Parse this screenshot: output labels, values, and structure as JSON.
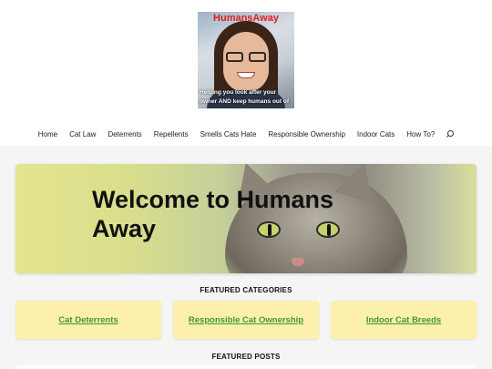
{
  "site": {
    "logo_title": "HumansAway",
    "logo_tagline": "Helping you look after your owner AND keep humans out of your way"
  },
  "nav": {
    "items": [
      {
        "label": "Home"
      },
      {
        "label": "Cat Law"
      },
      {
        "label": "Deterrents"
      },
      {
        "label": "Repellents"
      },
      {
        "label": "Smells Cats Hate"
      },
      {
        "label": "Responsible Ownership"
      },
      {
        "label": "Indoor Cats"
      },
      {
        "label": "How To?"
      }
    ],
    "search_icon": "search-icon"
  },
  "hero": {
    "title": "Welcome to Humans Away"
  },
  "featured_categories": {
    "heading": "FEATURED CATEGORIES",
    "items": [
      {
        "label": "Cat Deterrents"
      },
      {
        "label": "Responsible Cat Ownership"
      },
      {
        "label": "Indoor Cat Breeds"
      }
    ]
  },
  "featured_posts": {
    "heading": "FEATURED POSTS"
  },
  "colors": {
    "page_bg": "#f5f5f5",
    "card_bg": "#fdf0ad",
    "card_text": "#3f9a2f",
    "logo_title": "#e11d1d"
  }
}
